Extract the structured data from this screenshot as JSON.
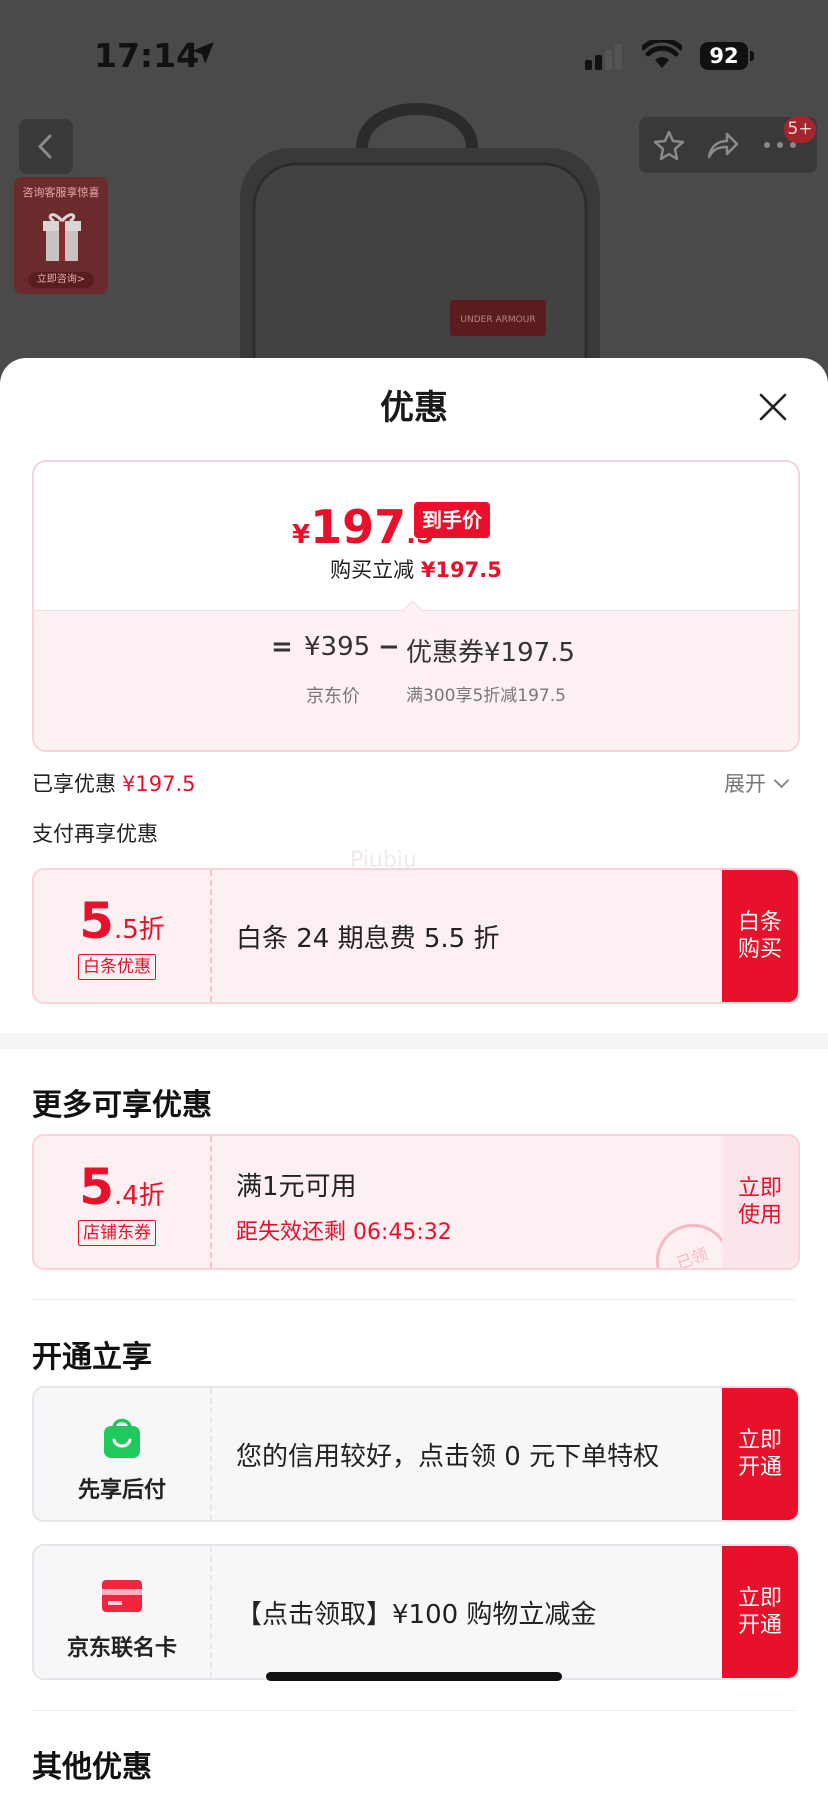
{
  "status": {
    "time": "17:14",
    "battery": "92"
  },
  "background": {
    "badge": "5+",
    "promo_title": "咨询客服享惊喜",
    "promo_button": "立即咨询>"
  },
  "sheet": {
    "title": "优惠",
    "price": {
      "currency": "¥",
      "integer": "197",
      "decimal": ".5",
      "tag": "到手价",
      "reduce_label": "购买立减",
      "reduce_value": "¥197.5",
      "eq": "=",
      "jd_price": "¥395",
      "minus": "−",
      "coupon_value": "优惠券¥197.5",
      "jd_label": "京东价",
      "coupon_desc": "满300享5折减197.5"
    },
    "enjoyed_label": "已享优惠",
    "enjoyed_value": "¥197.5",
    "expand_label": "展开",
    "pay_more_label": "支付再享优惠",
    "watermark": "Piubiu",
    "baitiao": {
      "disc_big": "5",
      "disc_small": ".5折",
      "tag": "白条优惠",
      "text": "白条 24 期息费 5.5 折",
      "button": "白条\n购买"
    },
    "more_title": "更多可享优惠",
    "store_coupon": {
      "disc_big": "5",
      "disc_small": ".4折",
      "tag": "店铺东券",
      "line1": "满1元可用",
      "line2": "距失效还剩 06:45:32",
      "stamp": "已领",
      "button": "立即\n使用"
    },
    "open_title": "开通立享",
    "pay_later": {
      "label": "先享后付",
      "text": "您的信用较好，点击领 0 元下单特权",
      "button": "立即\n开通"
    },
    "cobrand_card": {
      "label": "京东联名卡",
      "text": "【点击领取】¥100 购物立减金",
      "button": "立即\n开通"
    },
    "other_title": "其他优惠"
  },
  "colors": {
    "accent": "#e8102a",
    "coupon_bg": "#fdf0f3",
    "border": "#f8d3d8",
    "green": "#1fc95b"
  }
}
